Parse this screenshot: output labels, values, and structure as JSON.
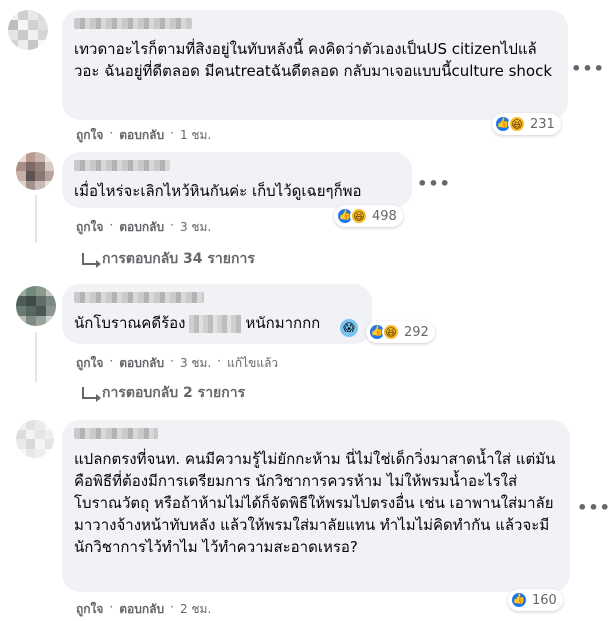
{
  "comments": [
    {
      "text": "เทวดาอะไรก็ตามที่สิงอยู่ในทับหลังนี้ คงคิดว่าตัวเองเป็นUS citizenไปแล้วอะ ฉันอยู่ที่ดีตลอด มีคนtreatฉันดีตลอด กลับมาเจอแบบนี้culture shock",
      "like_label": "ถูกใจ",
      "reply_label": "ตอบกลับ",
      "time": "1 ชม.",
      "reaction_count": "231",
      "reaction_icons": [
        "like-icon",
        "haha-icon"
      ],
      "avatar_colors": [
        "#d9d9d9",
        "#eeeeee",
        "#c8c8c8",
        "#f2f2f2"
      ]
    },
    {
      "text": "เมื่อไหร่จะเลิกไหว้หินกันค่ะ เก็บไว้ดูเฉยๆก็พอ",
      "like_label": "ถูกใจ",
      "reply_label": "ตอบกลับ",
      "time": "3 ชม.",
      "reaction_count": "498",
      "reaction_icons": [
        "like-icon",
        "haha-icon"
      ],
      "replies_label": "การตอบกลับ 34 รายการ",
      "avatar_colors": [
        "#b89a8e",
        "#7d6a66",
        "#c4b0a6",
        "#5e5352"
      ]
    },
    {
      "text_before": "นักโบราณคดีร้อง",
      "text_after": "หนักมากกก",
      "trailing_emoji": "scream-emoji",
      "like_label": "ถูกใจ",
      "reply_label": "ตอบกลับ",
      "time": "3 ชม.",
      "edited_label": "แก้ไขแล้ว",
      "reaction_count": "292",
      "reaction_icons": [
        "like-icon",
        "haha-icon"
      ],
      "replies_label": "การตอบกลับ 2 รายการ",
      "avatar_colors": [
        "#6f8a7f",
        "#a0a89b",
        "#4d5e5a",
        "#8c9a8c"
      ]
    },
    {
      "text": "แปลกตรงที่จนท. คนมีความรู้ไม่ยักกะห้าม นี่ไม่ใช่เด็กวิ่งมาสาดน้ำใส่ แต่มันคือพิธีที่ต้องมีการเตรียมการ นักวิชาการควรห้าม ไม่ให้พรมน้ำอะไรใส่โบราณวัตถุ หรือถ้าห้ามไม่ได้ก็จัดพิธีให้พรมไปตรงอื่น เช่น เอาพานใส่มาลัยมาวางจ้างหน้าทับหลัง แล้วให้พรมใส่มาลัยแทน ทำไมไม่คิดทำกัน แล้วจะมีนักวิชาการไว้ทำไม ไว้ทำความสะอาดเหรอ?",
      "like_label": "ถูกใจ",
      "reply_label": "ตอบกลับ",
      "time": "2 ชม.",
      "reaction_count": "160",
      "reaction_icons": [
        "like-icon"
      ],
      "avatar_colors": [
        "#e6e6e6",
        "#f3f3f3",
        "#dcdcdc",
        "#efefef"
      ]
    }
  ],
  "separator": "·",
  "more_label": "•••",
  "colors": {
    "bubble": "#f0f2f5",
    "secondary_text": "#65676b",
    "like_blue": "#1877f2",
    "haha_yellow": "#f7b928"
  }
}
